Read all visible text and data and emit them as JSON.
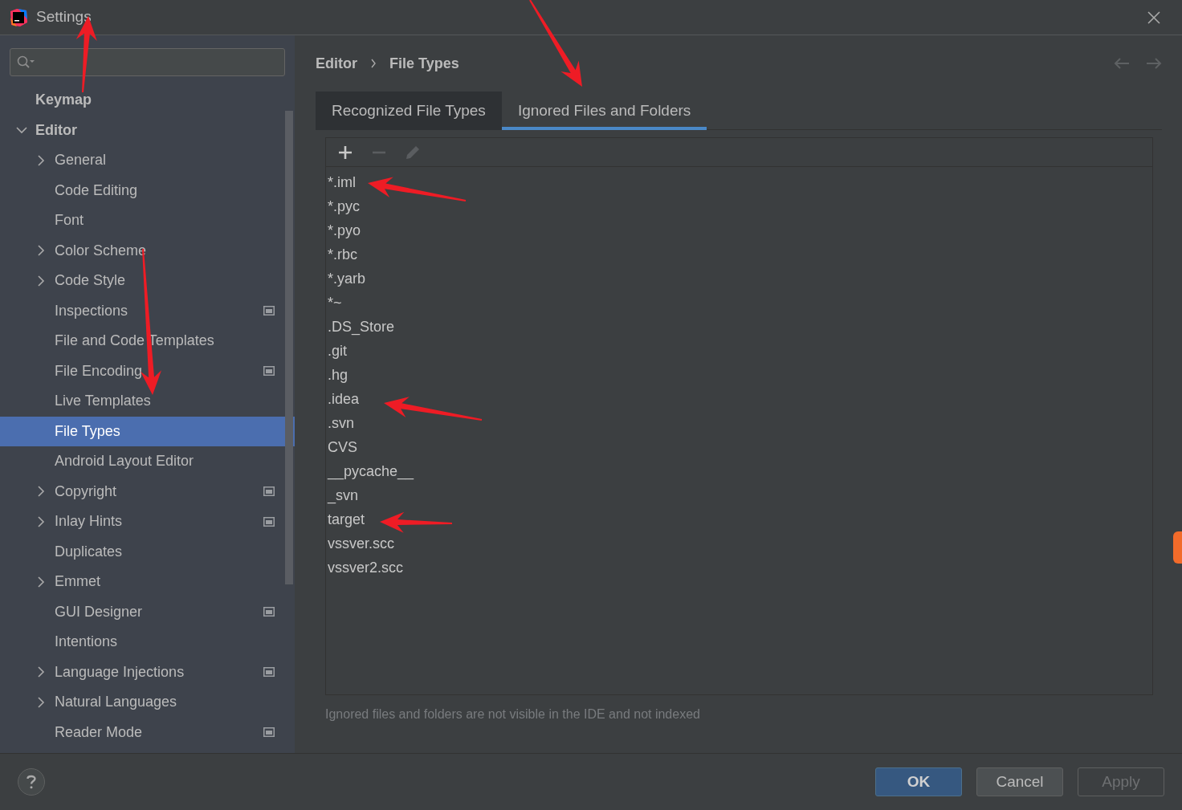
{
  "window": {
    "title": "Settings"
  },
  "sidebar": {
    "items": [
      {
        "label": "Keymap",
        "selected": false,
        "project_level": false
      },
      {
        "label": "Editor",
        "selected": false,
        "project_level": false,
        "expanded": true,
        "children": [
          {
            "label": "General",
            "selected": false,
            "project_level": false,
            "expanded": false
          },
          {
            "label": "Code Editing",
            "selected": false,
            "project_level": false
          },
          {
            "label": "Font",
            "selected": false,
            "project_level": false
          },
          {
            "label": "Color Scheme",
            "selected": false,
            "project_level": false,
            "expanded": false
          },
          {
            "label": "Code Style",
            "selected": false,
            "project_level": false,
            "expanded": false
          },
          {
            "label": "Inspections",
            "selected": false,
            "project_level": true
          },
          {
            "label": "File and Code Templates",
            "selected": false,
            "project_level": false
          },
          {
            "label": "File Encoding",
            "selected": false,
            "project_level": true
          },
          {
            "label": "Live Templates",
            "selected": false,
            "project_level": false
          },
          {
            "label": "File Types",
            "selected": true,
            "project_level": false
          },
          {
            "label": "Android Layout Editor",
            "selected": false,
            "project_level": false
          },
          {
            "label": "Copyright",
            "selected": false,
            "project_level": true,
            "expanded": false
          },
          {
            "label": "Inlay Hints",
            "selected": false,
            "project_level": true,
            "expanded": false
          },
          {
            "label": "Duplicates",
            "selected": false,
            "project_level": false
          },
          {
            "label": "Emmet",
            "selected": false,
            "project_level": false,
            "expanded": false
          },
          {
            "label": "GUI Designer",
            "selected": false,
            "project_level": true
          },
          {
            "label": "Intentions",
            "selected": false,
            "project_level": false
          },
          {
            "label": "Language Injections",
            "selected": false,
            "project_level": true,
            "expanded": false
          },
          {
            "label": "Natural Languages",
            "selected": false,
            "project_level": false,
            "expanded": false
          },
          {
            "label": "Reader Mode",
            "selected": false,
            "project_level": true
          }
        ]
      }
    ]
  },
  "breadcrumb": [
    "Editor",
    "File Types"
  ],
  "tabs": [
    {
      "label": "Recognized File Types",
      "selected": false
    },
    {
      "label": "Ignored Files and Folders",
      "selected": true
    }
  ],
  "toolbar": [
    {
      "kind": "add",
      "disabled": false
    },
    {
      "kind": "remove",
      "disabled": true
    },
    {
      "kind": "edit",
      "disabled": true
    }
  ],
  "ignored": [
    "*.iml",
    "*.pyc",
    "*.pyo",
    "*.rbc",
    "*.yarb",
    "*~",
    ".DS_Store",
    ".git",
    ".hg",
    ".idea",
    ".svn",
    "CVS",
    "__pycache__",
    "_svn",
    "target",
    "vssver.scc",
    "vssver2.scc"
  ],
  "hint": "Ignored files and folders are not visible in the IDE and not indexed",
  "buttons": [
    {
      "label": "OK",
      "kind": "default",
      "disabled": false
    },
    {
      "label": "Cancel",
      "kind": "normal",
      "disabled": false
    },
    {
      "label": "Apply",
      "kind": "normal",
      "disabled": true
    }
  ]
}
